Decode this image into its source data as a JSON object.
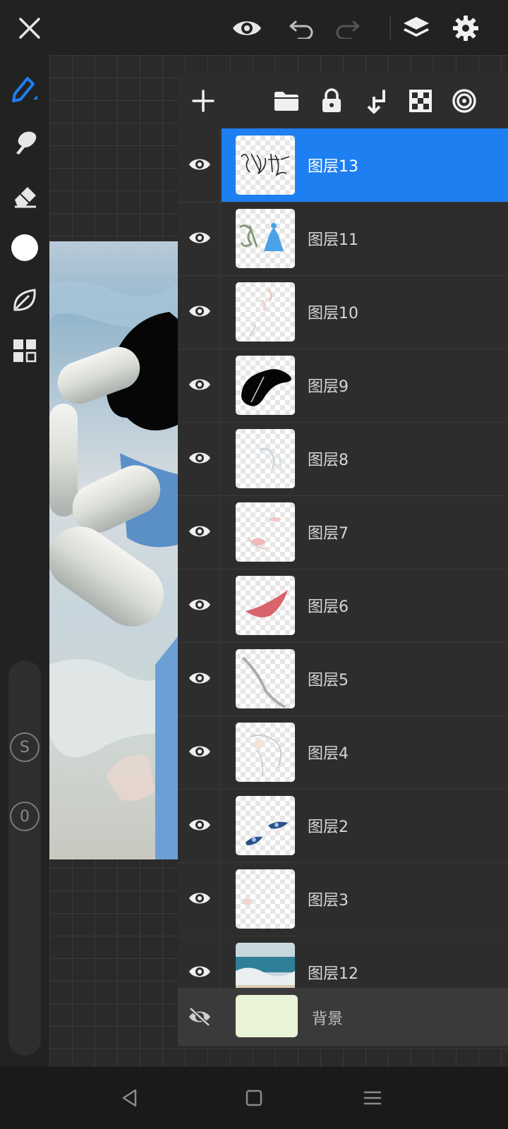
{
  "app": {
    "accent": "#1e7ff0"
  },
  "topbar": {
    "icons": [
      "close-icon",
      "eye-icon",
      "undo-icon",
      "redo-icon",
      "layers-icon",
      "settings-icon"
    ]
  },
  "tools": [
    "pen-icon",
    "smudge-icon",
    "eraser-icon",
    "color-swatch",
    "leaf-icon",
    "grid-icon"
  ],
  "left_sliders": {
    "size_label": "S",
    "opacity_label": "0"
  },
  "layers_toolbar": {
    "icons": [
      "add-layer-icon",
      "folder-icon",
      "lock-icon",
      "merge-down-icon",
      "checker-icon",
      "target-icon"
    ]
  },
  "layers": [
    {
      "name": "图层13",
      "selected": true
    },
    {
      "name": "图层11",
      "selected": false
    },
    {
      "name": "图层10",
      "selected": false
    },
    {
      "name": "图层9",
      "selected": false
    },
    {
      "name": "图层8",
      "selected": false
    },
    {
      "name": "图层7",
      "selected": false
    },
    {
      "name": "图层6",
      "selected": false
    },
    {
      "name": "图层5",
      "selected": false
    },
    {
      "name": "图层4",
      "selected": false
    },
    {
      "name": "图层2",
      "selected": false
    },
    {
      "name": "图层3",
      "selected": false
    },
    {
      "name": "图层12",
      "selected": false
    }
  ],
  "background_layer": {
    "name": "背景",
    "color": "#e8f3d8",
    "visible": false
  },
  "navbar": {
    "icons": [
      "back-icon",
      "home-icon",
      "menu-icon"
    ]
  }
}
